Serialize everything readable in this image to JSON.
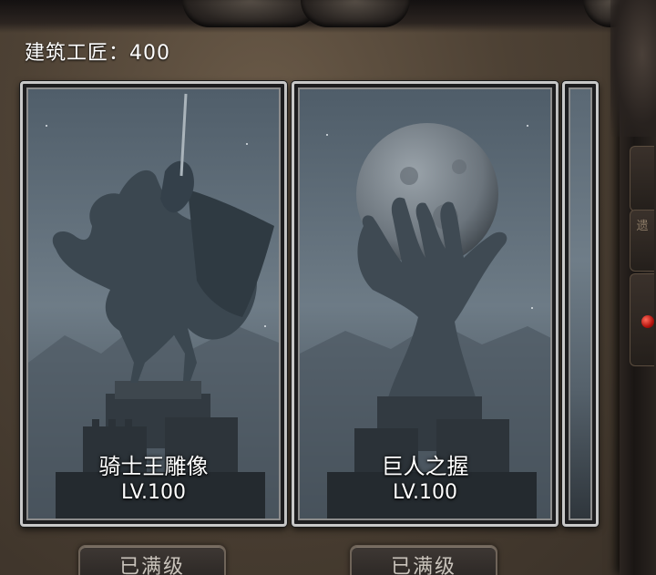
{
  "header": {
    "label": "建筑工匠：400"
  },
  "cards": [
    {
      "name": "骑士王雕像",
      "level": "LV.100",
      "button": "已满级",
      "art_icon": "knight-statue-icon"
    },
    {
      "name": "巨人之握",
      "level": "LV.100",
      "button": "已满级",
      "art_icon": "giant-hand-moon-icon"
    }
  ],
  "right_panel": {
    "tab_char": "遗"
  },
  "colors": {
    "background": "#4d4134",
    "card_border": "#c8c8c8",
    "notification_dot": "#b3130d",
    "text": "#ffffff"
  }
}
